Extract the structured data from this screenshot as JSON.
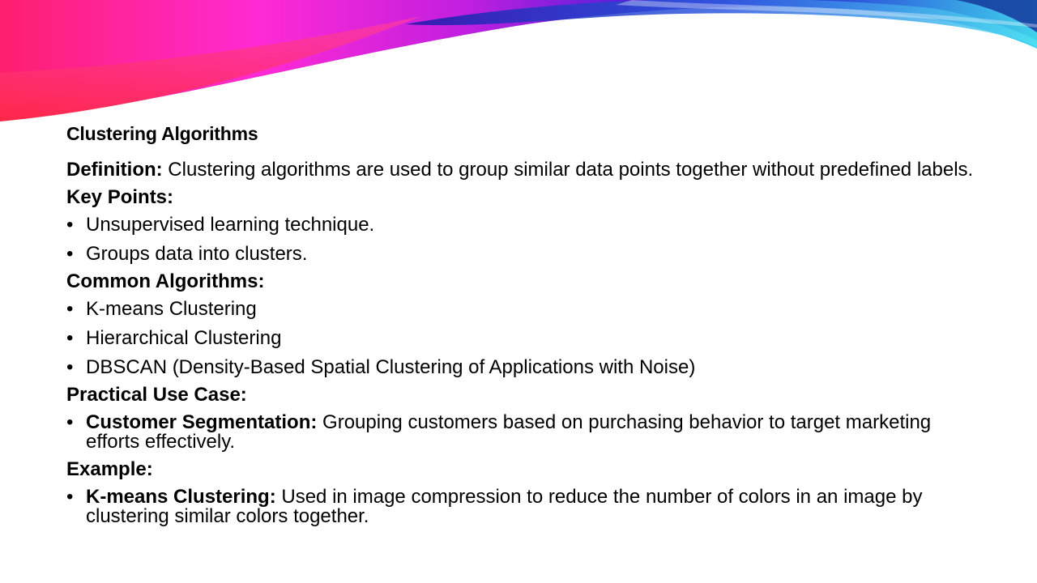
{
  "slide": {
    "title": "Clustering Algorithms",
    "definition": {
      "label": "Definition:",
      "text": " Clustering algorithms are used to group similar data points together without predefined labels."
    },
    "key_points": {
      "heading": "Key Points:",
      "items": [
        "Unsupervised learning technique.",
        "Groups data into clusters."
      ]
    },
    "common_algorithms": {
      "heading": "Common Algorithms:",
      "items": [
        "K-means Clustering",
        "Hierarchical Clustering",
        "DBSCAN (Density-Based Spatial Clustering of Applications with Noise)"
      ]
    },
    "practical_use_case": {
      "heading": "Practical Use Case:",
      "items": [
        {
          "label": "Customer Segmentation:",
          "text": " Grouping customers based on purchasing behavior to target marketing efforts effectively."
        }
      ]
    },
    "example": {
      "heading": "Example:",
      "items": [
        {
          "label": "K-means Clustering:",
          "text": " Used in image compression to reduce the number of colors in an image by clustering similar colors together."
        }
      ]
    }
  },
  "theme": {
    "accent_pink": "#ff2ad4",
    "accent_red": "#ff3a5c",
    "accent_purple": "#7a1fe0",
    "accent_blue": "#2b46d8",
    "accent_cyan": "#3fd2ec"
  }
}
